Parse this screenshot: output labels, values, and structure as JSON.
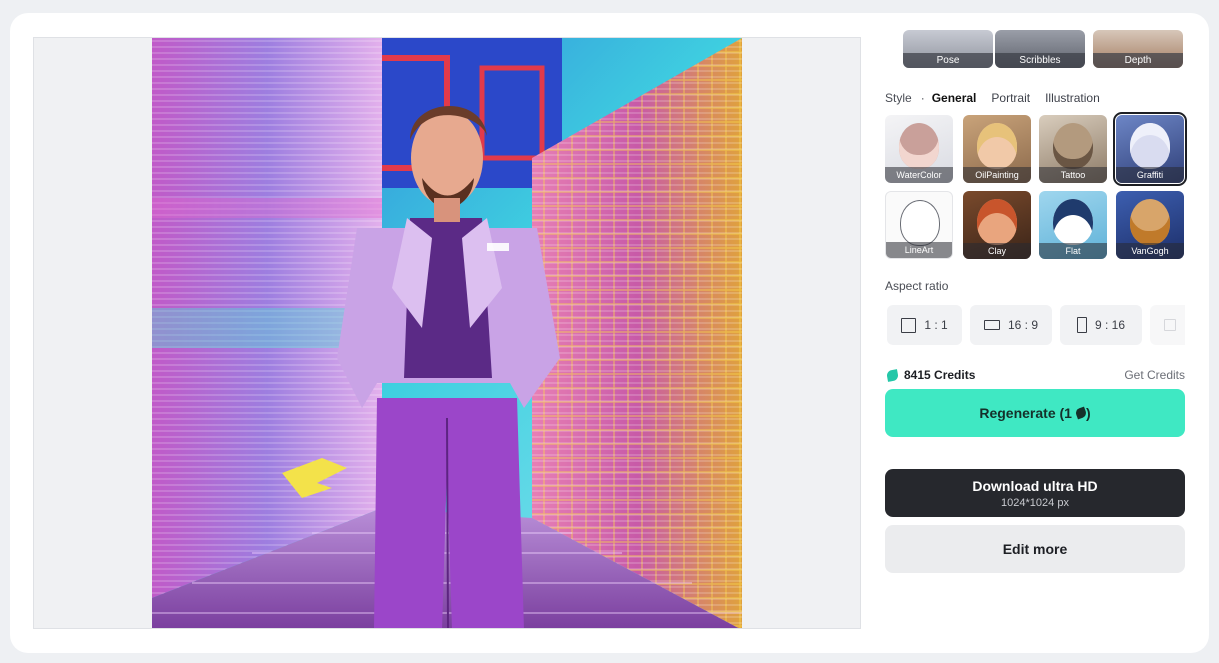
{
  "controls": [
    {
      "label": "Pose"
    },
    {
      "label": "Scribbles"
    },
    {
      "label": "Depth"
    }
  ],
  "style": {
    "title": "Style",
    "separator": "·",
    "tabs": [
      {
        "label": "General",
        "active": true
      },
      {
        "label": "Portrait",
        "active": false
      },
      {
        "label": "Illustration",
        "active": false
      }
    ],
    "items": [
      {
        "label": "WaterColor",
        "selected": false
      },
      {
        "label": "OilPainting",
        "selected": false
      },
      {
        "label": "Tattoo",
        "selected": false
      },
      {
        "label": "Graffiti",
        "selected": true
      },
      {
        "label": "LineArt",
        "selected": false
      },
      {
        "label": "Clay",
        "selected": false
      },
      {
        "label": "Flat",
        "selected": false
      },
      {
        "label": "VanGogh",
        "selected": false
      }
    ]
  },
  "aspect": {
    "title": "Aspect ratio",
    "options": [
      {
        "label": "1 : 1"
      },
      {
        "label": "16 : 9"
      },
      {
        "label": "9 : 16"
      },
      {
        "label": ""
      }
    ]
  },
  "credits": {
    "amount": "8415 Credits",
    "get_label": "Get Credits"
  },
  "buttons": {
    "regenerate": "Regenerate (1",
    "regenerate_close": ")",
    "download": "Download ultra HD",
    "download_size": "1024*1024 px",
    "edit": "Edit more"
  },
  "colors": {
    "accent": "#3fe8c3",
    "dark_button": "#26282d",
    "page_bg": "#eef0f3"
  }
}
